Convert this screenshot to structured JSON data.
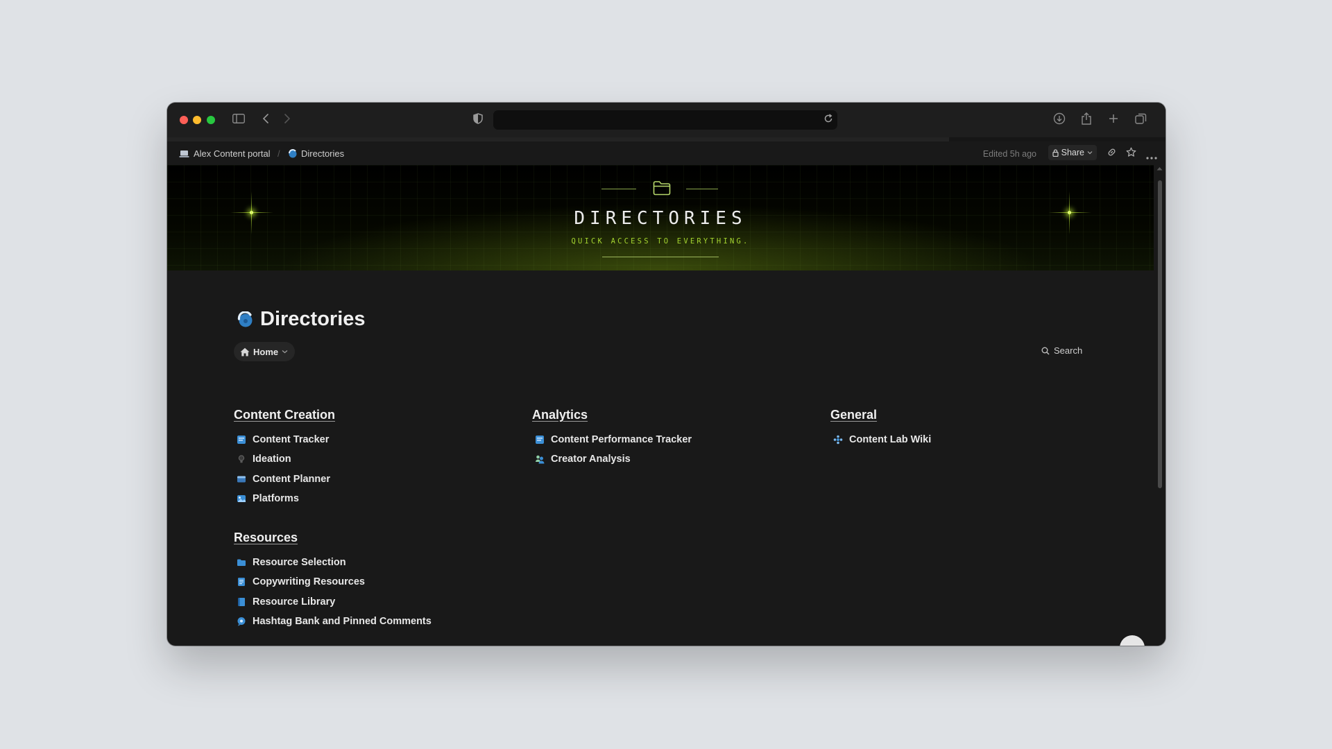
{
  "browser": {
    "url": ""
  },
  "breadcrumb": {
    "workspace": "Alex Content portal",
    "page": "Directories"
  },
  "topbar": {
    "edited": "Edited 5h ago",
    "share_label": "Share"
  },
  "banner": {
    "title": "DIRECTORIES",
    "subtitle": "QUICK ACCESS TO EVERYTHING."
  },
  "page": {
    "title": "Directories",
    "home_label": "Home",
    "search_label": "Search"
  },
  "sections": {
    "content_creation": {
      "title": "Content Creation",
      "items": [
        "Content Tracker",
        "Ideation",
        "Content Planner",
        "Platforms"
      ]
    },
    "resources": {
      "title": "Resources",
      "items": [
        "Resource Selection",
        "Copywriting Resources",
        "Resource Library",
        "Hashtag Bank and Pinned Comments"
      ]
    },
    "analytics": {
      "title": "Analytics",
      "items": [
        "Content Performance Tracker",
        "Creator Analysis"
      ]
    },
    "general": {
      "title": "General",
      "items": [
        "Content Lab Wiki"
      ]
    }
  },
  "colors": {
    "accent_green": "#a4d430",
    "page_bg": "#191919",
    "link_icon_blue": "#3b8fd6"
  }
}
